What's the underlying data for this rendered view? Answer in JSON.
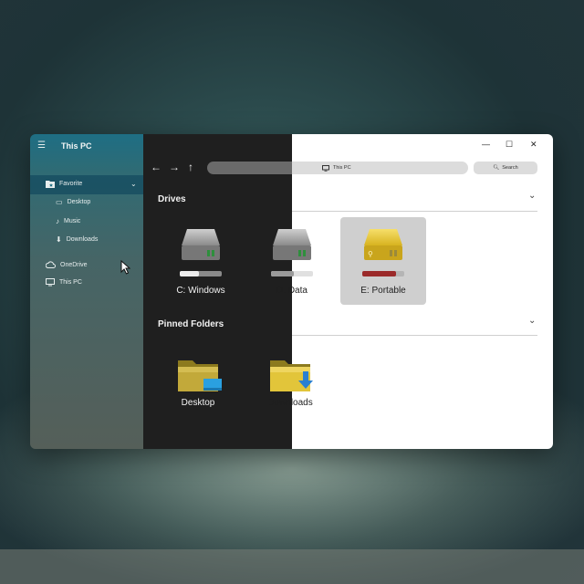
{
  "window": {
    "title": "This PC"
  },
  "sidebar": {
    "menu_icon": "hamburger-icon",
    "items": [
      {
        "label": "Favorite",
        "icon": "star-folder-icon",
        "expanded": true
      },
      {
        "label": "Desktop",
        "icon": "desktop-icon"
      },
      {
        "label": "Music",
        "icon": "music-note-icon"
      },
      {
        "label": "Downloads",
        "icon": "download-arrow-icon"
      },
      {
        "label": "OneDrive",
        "icon": "cloud-icon"
      },
      {
        "label": "This PC",
        "icon": "monitor-icon"
      }
    ]
  },
  "toolbar": {
    "address": "This PC",
    "search_label": "Search"
  },
  "titlebar": {
    "minimize": "—",
    "maximize": "☐",
    "close": "✕"
  },
  "drives_section": {
    "title": "Drives",
    "drives": [
      {
        "label": "C: Windows",
        "color": "#a9a9a9",
        "selected": false
      },
      {
        "label": "D: Data",
        "color": "#a9a9a9",
        "selected": false
      },
      {
        "label": "E: Portable",
        "color": "#e9c93a",
        "selected": true
      }
    ]
  },
  "pinned_section": {
    "title": "Pinned Folders",
    "folders": [
      {
        "label": "Desktop",
        "badge": "desktop-badge-icon"
      },
      {
        "label": "Downloads",
        "badge": "download-badge-icon"
      }
    ]
  },
  "colors": {
    "accent": "#1e6e84",
    "dark_pane": "#1f1f1f",
    "light_pane": "#ffffff",
    "selection": "#cfcfcf"
  }
}
